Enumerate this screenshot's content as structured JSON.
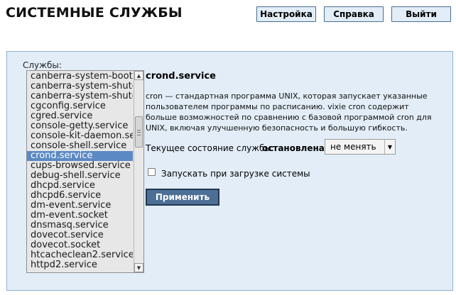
{
  "header": {
    "title": "СИСТЕМНЫЕ СЛУЖБЫ",
    "buttons": {
      "settings": "Настройка",
      "help": "Справка",
      "exit": "Выйти"
    }
  },
  "services": {
    "label": "Службы:",
    "items": [
      "canberra-system-boot",
      "canberra-system-shutd",
      "canberra-system-shutd",
      "cgconfig.service",
      "cgred.service",
      "console-getty.service",
      "console-kit-daemon.se",
      "console-shell.service",
      "crond.service",
      "cups-browsed.service",
      "debug-shell.service",
      "dhcpd.service",
      "dhcpd6.service",
      "dm-event.service",
      "dm-event.socket",
      "dnsmasq.service",
      "dovecot.service",
      "dovecot.socket",
      "htcacheclean2.service",
      "httpd2.service"
    ],
    "selected": "crond.service",
    "scrollbar": {
      "up_arrow": "▲",
      "down_arrow": "▼"
    }
  },
  "detail": {
    "title": "crond.service",
    "description": "cron — стандартная программа UNIX, которая запускает указанные пользователем программы по расписанию. vixie cron содержит больше возможностей по сравнению с базовой программой cron для UNIX, включая улучшенную безопасность и большую гибкость.",
    "state_label": "Текущее состояние службы:",
    "state_value": "остановлена",
    "action_select": {
      "value": "не менять",
      "arrow": "▼"
    },
    "autostart_label": "Запускать при загрузке системы",
    "autostart_checked": false,
    "apply_label": "Применить"
  },
  "colors": {
    "panel_bg": "#e2edf7",
    "selected_bg": "#5b89c3",
    "apply_bg": "#4d6f96"
  }
}
